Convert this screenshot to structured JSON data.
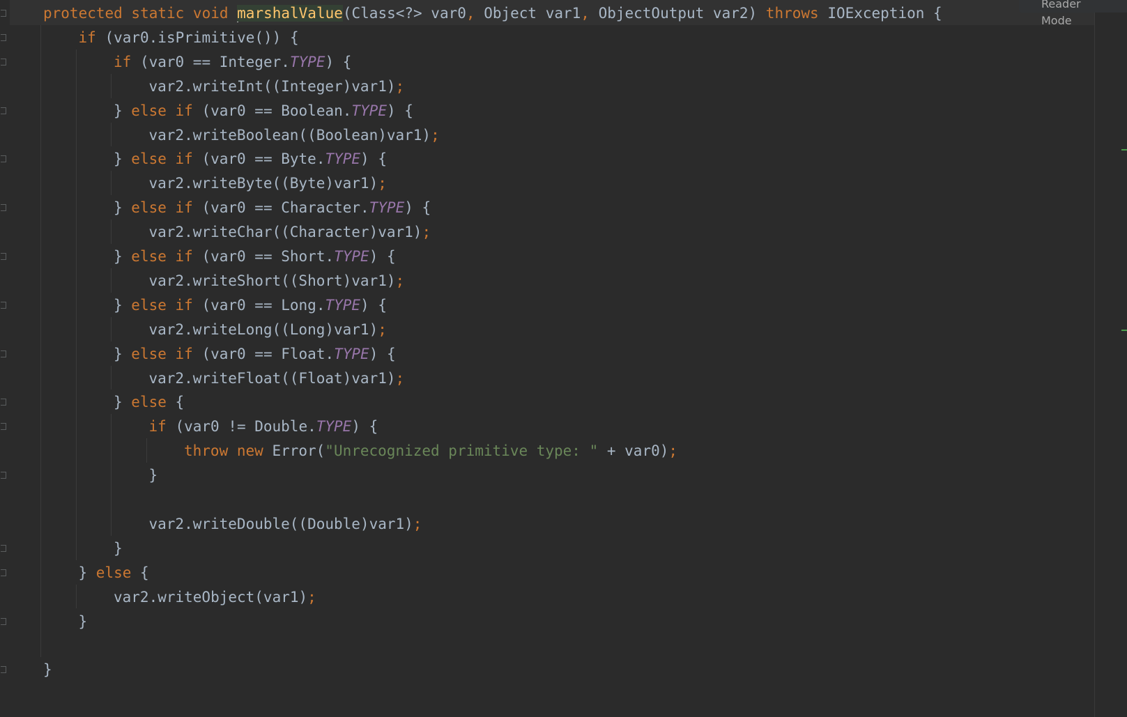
{
  "toolbar": {
    "reader_mode_label": "Reader Mode"
  },
  "colors": {
    "background": "#2b2b2b",
    "keyword": "#cc7832",
    "function": "#ffc66d",
    "constant": "#9876aa",
    "string": "#6a8759",
    "text": "#a9b7c6"
  },
  "code": {
    "lines": [
      {
        "indent": 0,
        "tokens": [
          [
            "kw",
            "protected static void "
          ],
          [
            "caret",
            ""
          ],
          [
            "fn",
            "marshalValue"
          ],
          [
            "plain",
            "(Class<?> var0"
          ],
          [
            "semi",
            ","
          ],
          [
            "plain",
            " Object var1"
          ],
          [
            "semi",
            ","
          ],
          [
            "plain",
            " ObjectOutput var2) "
          ],
          [
            "kw",
            "throws "
          ],
          [
            "plain",
            "IOException {"
          ]
        ]
      },
      {
        "indent": 1,
        "tokens": [
          [
            "kw",
            "if "
          ],
          [
            "plain",
            "(var0.isPrimitive()) {"
          ]
        ]
      },
      {
        "indent": 2,
        "tokens": [
          [
            "kw",
            "if "
          ],
          [
            "plain",
            "(var0 == Integer."
          ],
          [
            "const",
            "TYPE"
          ],
          [
            "plain",
            ") {"
          ]
        ]
      },
      {
        "indent": 3,
        "tokens": [
          [
            "plain",
            "var2.writeInt((Integer)var1)"
          ],
          [
            "semi",
            ";"
          ]
        ]
      },
      {
        "indent": 2,
        "tokens": [
          [
            "plain",
            "} "
          ],
          [
            "kw",
            "else if "
          ],
          [
            "plain",
            "(var0 == Boolean."
          ],
          [
            "const",
            "TYPE"
          ],
          [
            "plain",
            ") {"
          ]
        ]
      },
      {
        "indent": 3,
        "tokens": [
          [
            "plain",
            "var2.writeBoolean((Boolean)var1)"
          ],
          [
            "semi",
            ";"
          ]
        ]
      },
      {
        "indent": 2,
        "tokens": [
          [
            "plain",
            "} "
          ],
          [
            "kw",
            "else if "
          ],
          [
            "plain",
            "(var0 == Byte."
          ],
          [
            "const",
            "TYPE"
          ],
          [
            "plain",
            ") {"
          ]
        ]
      },
      {
        "indent": 3,
        "tokens": [
          [
            "plain",
            "var2.writeByte((Byte)var1)"
          ],
          [
            "semi",
            ";"
          ]
        ]
      },
      {
        "indent": 2,
        "tokens": [
          [
            "plain",
            "} "
          ],
          [
            "kw",
            "else if "
          ],
          [
            "plain",
            "(var0 == Character."
          ],
          [
            "const",
            "TYPE"
          ],
          [
            "plain",
            ") {"
          ]
        ]
      },
      {
        "indent": 3,
        "tokens": [
          [
            "plain",
            "var2.writeChar((Character)var1)"
          ],
          [
            "semi",
            ";"
          ]
        ]
      },
      {
        "indent": 2,
        "tokens": [
          [
            "plain",
            "} "
          ],
          [
            "kw",
            "else if "
          ],
          [
            "plain",
            "(var0 == Short."
          ],
          [
            "const",
            "TYPE"
          ],
          [
            "plain",
            ") {"
          ]
        ]
      },
      {
        "indent": 3,
        "tokens": [
          [
            "plain",
            "var2.writeShort((Short)var1)"
          ],
          [
            "semi",
            ";"
          ]
        ]
      },
      {
        "indent": 2,
        "tokens": [
          [
            "plain",
            "} "
          ],
          [
            "kw",
            "else if "
          ],
          [
            "plain",
            "(var0 == Long."
          ],
          [
            "const",
            "TYPE"
          ],
          [
            "plain",
            ") {"
          ]
        ]
      },
      {
        "indent": 3,
        "tokens": [
          [
            "plain",
            "var2.writeLong((Long)var1)"
          ],
          [
            "semi",
            ";"
          ]
        ]
      },
      {
        "indent": 2,
        "tokens": [
          [
            "plain",
            "} "
          ],
          [
            "kw",
            "else if "
          ],
          [
            "plain",
            "(var0 == Float."
          ],
          [
            "const",
            "TYPE"
          ],
          [
            "plain",
            ") {"
          ]
        ]
      },
      {
        "indent": 3,
        "tokens": [
          [
            "plain",
            "var2.writeFloat((Float)var1)"
          ],
          [
            "semi",
            ";"
          ]
        ]
      },
      {
        "indent": 2,
        "tokens": [
          [
            "plain",
            "} "
          ],
          [
            "kw",
            "else "
          ],
          [
            "plain",
            "{"
          ]
        ]
      },
      {
        "indent": 3,
        "tokens": [
          [
            "kw",
            "if "
          ],
          [
            "plain",
            "(var0 != Double."
          ],
          [
            "const",
            "TYPE"
          ],
          [
            "plain",
            ") {"
          ]
        ]
      },
      {
        "indent": 4,
        "tokens": [
          [
            "kw",
            "throw new "
          ],
          [
            "plain",
            "Error("
          ],
          [
            "str",
            "\"Unrecognized primitive type: \""
          ],
          [
            "plain",
            " + var0)"
          ],
          [
            "semi",
            ";"
          ]
        ]
      },
      {
        "indent": 3,
        "tokens": [
          [
            "plain",
            "}"
          ]
        ]
      },
      {
        "indent": 3,
        "tokens": []
      },
      {
        "indent": 3,
        "tokens": [
          [
            "plain",
            "var2.writeDouble((Double)var1)"
          ],
          [
            "semi",
            ";"
          ]
        ]
      },
      {
        "indent": 2,
        "tokens": [
          [
            "plain",
            "}"
          ]
        ]
      },
      {
        "indent": 1,
        "tokens": [
          [
            "plain",
            "} "
          ],
          [
            "kw",
            "else "
          ],
          [
            "plain",
            "{"
          ]
        ]
      },
      {
        "indent": 2,
        "tokens": [
          [
            "plain",
            "var2.writeObject(var1)"
          ],
          [
            "semi",
            ";"
          ]
        ]
      },
      {
        "indent": 1,
        "tokens": [
          [
            "plain",
            "}"
          ]
        ]
      },
      {
        "indent": 0,
        "tokens": []
      },
      {
        "indent": 0,
        "tokens": [
          [
            "plain",
            "}"
          ]
        ]
      }
    ]
  }
}
